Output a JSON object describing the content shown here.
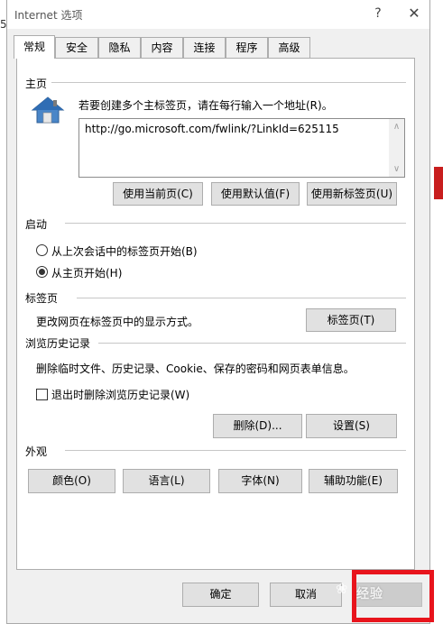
{
  "background": {
    "left_digit": "5"
  },
  "window": {
    "title": "Internet 选项",
    "help_glyph": "?",
    "close_glyph": "✕"
  },
  "tabs": [
    {
      "label": "常规",
      "active": true
    },
    {
      "label": "安全",
      "active": false
    },
    {
      "label": "隐私",
      "active": false
    },
    {
      "label": "内容",
      "active": false
    },
    {
      "label": "连接",
      "active": false
    },
    {
      "label": "程序",
      "active": false
    },
    {
      "label": "高级",
      "active": false
    }
  ],
  "homepage": {
    "section_title": "主页",
    "instruction": "若要创建多个主标签页，请在每行输入一个地址(R)。",
    "url_value": "http://go.microsoft.com/fwlink/?LinkId=625115",
    "buttons": {
      "use_current": "使用当前页(C)",
      "use_default": "使用默认值(F)",
      "use_new_tab": "使用新标签页(U)"
    }
  },
  "startup": {
    "section_title": "启动",
    "options": [
      {
        "label": "从上次会话中的标签页开始(B)",
        "checked": false
      },
      {
        "label": "从主页开始(H)",
        "checked": true
      }
    ]
  },
  "tabs_section": {
    "section_title": "标签页",
    "description": "更改网页在标签页中的显示方式。",
    "button": "标签页(T)"
  },
  "history": {
    "section_title": "浏览历史记录",
    "description": "删除临时文件、历史记录、Cookie、保存的密码和网页表单信息。",
    "checkbox_label": "退出时删除浏览历史记录(W)",
    "checkbox_checked": false,
    "delete_button": "删除(D)...",
    "settings_button": "设置(S)"
  },
  "appearance": {
    "section_title": "外观",
    "buttons": {
      "colors": "颜色(O)",
      "languages": "语言(L)",
      "fonts": "字体(N)",
      "accessibility": "辅助功能(E)"
    }
  },
  "footer": {
    "ok": "确定",
    "cancel": "取消",
    "apply_watermark": "经验"
  },
  "colors": {
    "highlight_box": "#e8141c"
  }
}
